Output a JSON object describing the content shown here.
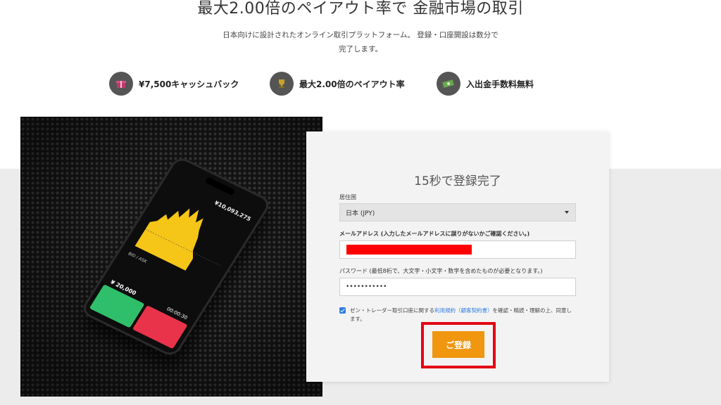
{
  "hero": {
    "headline": "最大2.00倍のペイアウト率で 金融市場の取引",
    "subtext_line1": "日本向けに設計されたオンライン取引プラットフォーム。 登録・口座開設は数分で",
    "subtext_line2": "完了します。"
  },
  "features": [
    {
      "icon": "gift-icon",
      "label": "¥7,500キャッシュバック",
      "icon_color": "#c0396b"
    },
    {
      "icon": "trophy-icon",
      "label": "最大2.00倍のペイアウト率",
      "icon_color": "#c9a227"
    },
    {
      "icon": "cash-icon",
      "label": "入出金手数料無料",
      "icon_color": "#6aa84f"
    }
  ],
  "phone": {
    "balance": "¥10,093,275",
    "amount": "¥ 20,000",
    "time": "00:00:30"
  },
  "form": {
    "title": "15秒で登録完了",
    "country_label": "居住国",
    "country_value": "日本 (JPY)",
    "email_label": "メールアドレス (入力したメールアドレスに誤りがないかご確認ください。)",
    "password_label": "パスワード (最低8桁で、大文字・小文字・数字を含めたものが必要となります。)",
    "password_value": "•••••••••••",
    "terms_prefix": "ゼン・トレーダー取引口座に関する",
    "terms_link": "利用規約（顧客契約書）",
    "terms_suffix": "を確認・精読・理解の上、同意します。",
    "terms_checked": true,
    "submit_label": "ご登録"
  },
  "colors": {
    "accent_orange": "#f0960f",
    "highlight_red": "#e30613",
    "checkbox_blue": "#2f7de1"
  }
}
